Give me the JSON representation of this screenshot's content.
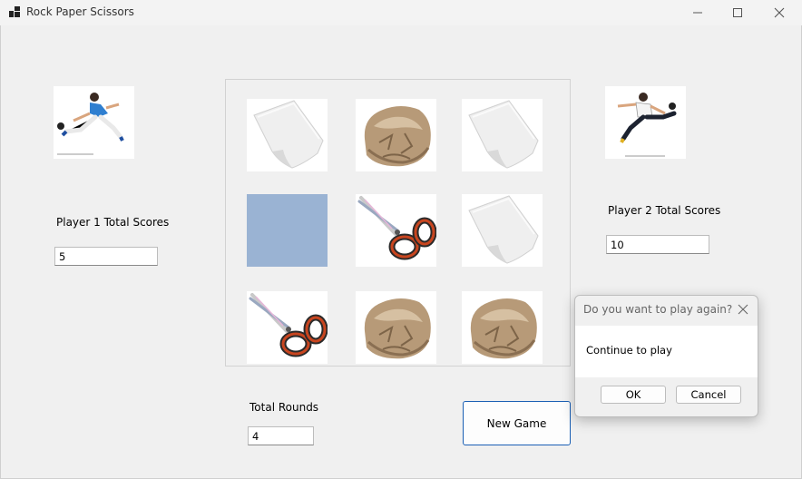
{
  "window": {
    "title": "Rock Paper Scissors"
  },
  "player1": {
    "label": "Player 1 Total Scores",
    "score": "5"
  },
  "player2": {
    "label": "Player 2 Total Scores",
    "score": "10"
  },
  "board": {
    "cells": [
      "paper",
      "rock",
      "paper",
      "empty",
      "scissors",
      "paper",
      "scissors",
      "rock",
      "rock"
    ]
  },
  "rounds": {
    "label": "Total Rounds",
    "value": "4"
  },
  "new_game": {
    "label": "New Game"
  },
  "dialog": {
    "title": "Do you want to play again?",
    "message": "Continue to play",
    "ok": "OK",
    "cancel": "Cancel"
  },
  "colors": {
    "empty_cell": "#9ab3d3",
    "accent": "#1a5fb4"
  }
}
